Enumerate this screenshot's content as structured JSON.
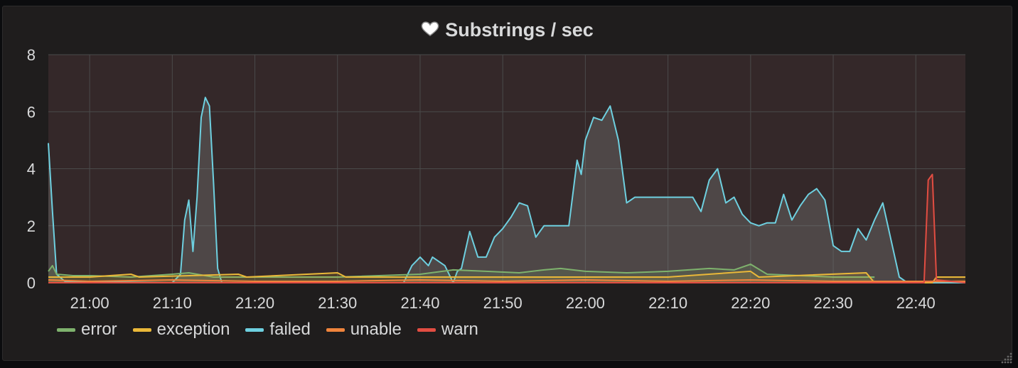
{
  "panel": {
    "title": "Substrings / sec",
    "icon": "heart-icon"
  },
  "colors": {
    "plot_background": "#342829",
    "grid": "#4a4a4a",
    "text": "#d8d9da"
  },
  "chart_data": {
    "type": "line",
    "title": "Substrings / sec",
    "xlabel": "",
    "ylabel": "",
    "ylim": [
      0,
      8
    ],
    "xlim": [
      "20:55",
      "22:46"
    ],
    "x_ticks": [
      "21:00",
      "21:10",
      "21:20",
      "21:30",
      "21:40",
      "21:50",
      "22:00",
      "22:10",
      "22:20",
      "22:30",
      "22:40"
    ],
    "y_ticks": [
      "0",
      "2",
      "4",
      "6",
      "8"
    ],
    "grid": true,
    "legend_position": "bottom-left",
    "series": [
      {
        "name": "error",
        "color": "#7eb26d",
        "points": [
          [
            "20:55",
            0.4
          ],
          [
            "20:55:30",
            0.6
          ],
          [
            "20:56",
            0.3
          ],
          [
            "20:58",
            0.25
          ],
          [
            "21:00",
            0.25
          ],
          [
            "21:05",
            0.2
          ],
          [
            "21:10",
            0.3
          ],
          [
            "21:12",
            0.35
          ],
          [
            "21:15",
            0.2
          ],
          [
            "21:20",
            0.2
          ],
          [
            "21:30",
            0.2
          ],
          [
            "21:40",
            0.3
          ],
          [
            "21:44",
            0.45
          ],
          [
            "21:48",
            0.4
          ],
          [
            "21:52",
            0.35
          ],
          [
            "21:55",
            0.45
          ],
          [
            "21:57",
            0.5
          ],
          [
            "22:00",
            0.4
          ],
          [
            "22:05",
            0.35
          ],
          [
            "22:10",
            0.4
          ],
          [
            "22:15",
            0.5
          ],
          [
            "22:18",
            0.45
          ],
          [
            "22:20",
            0.65
          ],
          [
            "22:22",
            0.3
          ],
          [
            "22:30",
            0.2
          ],
          [
            "22:35",
            0.2
          ]
        ]
      },
      {
        "name": "exception",
        "color": "#eab839",
        "points": [
          [
            "20:55",
            0.2
          ],
          [
            "21:00",
            0.2
          ],
          [
            "21:05",
            0.3
          ],
          [
            "21:06",
            0.2
          ],
          [
            "21:18",
            0.3
          ],
          [
            "21:19",
            0.2
          ],
          [
            "21:30",
            0.35
          ],
          [
            "21:31",
            0.2
          ],
          [
            "21:45",
            0.2
          ],
          [
            "22:00",
            0.2
          ],
          [
            "22:10",
            0.2
          ],
          [
            "22:20",
            0.4
          ],
          [
            "22:21",
            0.2
          ],
          [
            "22:34",
            0.35
          ],
          [
            "22:35",
            0.0
          ],
          [
            "22:42",
            0.0
          ],
          [
            "22:42:30",
            0.2
          ],
          [
            "22:46",
            0.2
          ]
        ]
      },
      {
        "name": "failed",
        "color": "#6ed0e0",
        "points": [
          [
            "20:55",
            4.9
          ],
          [
            "20:55:30",
            2.5
          ],
          [
            "20:56",
            0.3
          ],
          [
            "20:57",
            0.05
          ],
          [
            "21:10",
            0.0
          ],
          [
            "21:11",
            0.3
          ],
          [
            "21:11:30",
            2.2
          ],
          [
            "21:12",
            2.9
          ],
          [
            "21:12:30",
            1.1
          ],
          [
            "21:13",
            3.0
          ],
          [
            "21:13:30",
            5.8
          ],
          [
            "21:14",
            6.5
          ],
          [
            "21:14:30",
            6.2
          ],
          [
            "21:15",
            3.5
          ],
          [
            "21:15:30",
            0.5
          ],
          [
            "21:16",
            0.0
          ],
          [
            "21:38",
            0.0
          ],
          [
            "21:39",
            0.6
          ],
          [
            "21:40",
            0.9
          ],
          [
            "21:41",
            0.6
          ],
          [
            "21:41:30",
            0.9
          ],
          [
            "21:42",
            0.8
          ],
          [
            "21:43",
            0.6
          ],
          [
            "21:44",
            0.0
          ],
          [
            "21:44:30",
            0.4
          ],
          [
            "21:45",
            0.5
          ],
          [
            "21:46",
            1.8
          ],
          [
            "21:47",
            0.9
          ],
          [
            "21:48",
            0.9
          ],
          [
            "21:49",
            1.6
          ],
          [
            "21:50",
            1.9
          ],
          [
            "21:51",
            2.3
          ],
          [
            "21:52",
            2.8
          ],
          [
            "21:53",
            2.7
          ],
          [
            "21:54",
            1.6
          ],
          [
            "21:55",
            2.0
          ],
          [
            "21:58",
            2.0
          ],
          [
            "21:59",
            4.3
          ],
          [
            "21:59:30",
            3.8
          ],
          [
            "22:00",
            5.0
          ],
          [
            "22:01",
            5.8
          ],
          [
            "22:02",
            5.7
          ],
          [
            "22:03",
            6.2
          ],
          [
            "22:04",
            5.0
          ],
          [
            "22:05",
            2.8
          ],
          [
            "22:06",
            3.0
          ],
          [
            "22:10",
            3.0
          ],
          [
            "22:13",
            3.0
          ],
          [
            "22:14",
            2.5
          ],
          [
            "22:15",
            3.6
          ],
          [
            "22:16",
            4.0
          ],
          [
            "22:17",
            2.8
          ],
          [
            "22:18",
            3.0
          ],
          [
            "22:19",
            2.4
          ],
          [
            "22:20",
            2.1
          ],
          [
            "22:21",
            2.0
          ],
          [
            "22:22",
            2.1
          ],
          [
            "22:23",
            2.1
          ],
          [
            "22:24",
            3.1
          ],
          [
            "22:25",
            2.2
          ],
          [
            "22:26",
            2.7
          ],
          [
            "22:27",
            3.1
          ],
          [
            "22:28",
            3.3
          ],
          [
            "22:29",
            2.9
          ],
          [
            "22:30",
            1.3
          ],
          [
            "22:31",
            1.1
          ],
          [
            "22:32",
            1.1
          ],
          [
            "22:33",
            1.9
          ],
          [
            "22:34",
            1.5
          ],
          [
            "22:35",
            2.2
          ],
          [
            "22:36",
            2.8
          ],
          [
            "22:37",
            1.5
          ],
          [
            "22:38",
            0.2
          ],
          [
            "22:39",
            0.0
          ],
          [
            "22:46",
            0.0
          ]
        ]
      },
      {
        "name": "unable",
        "color": "#ef843c",
        "points": [
          [
            "20:55",
            0.1
          ],
          [
            "21:00",
            0.05
          ],
          [
            "21:10",
            0.1
          ],
          [
            "21:20",
            0.05
          ],
          [
            "21:30",
            0.05
          ],
          [
            "21:40",
            0.1
          ],
          [
            "21:50",
            0.05
          ],
          [
            "22:00",
            0.1
          ],
          [
            "22:10",
            0.05
          ],
          [
            "22:20",
            0.1
          ],
          [
            "22:30",
            0.05
          ],
          [
            "22:35",
            0.05
          ],
          [
            "22:46",
            0.05
          ]
        ]
      },
      {
        "name": "warn",
        "color": "#e24d42",
        "points": [
          [
            "20:55",
            0.0
          ],
          [
            "22:41",
            0.0
          ],
          [
            "22:41:30",
            3.6
          ],
          [
            "22:42",
            3.8
          ],
          [
            "22:42:30",
            0.1
          ],
          [
            "22:46",
            0.0
          ]
        ]
      }
    ]
  }
}
